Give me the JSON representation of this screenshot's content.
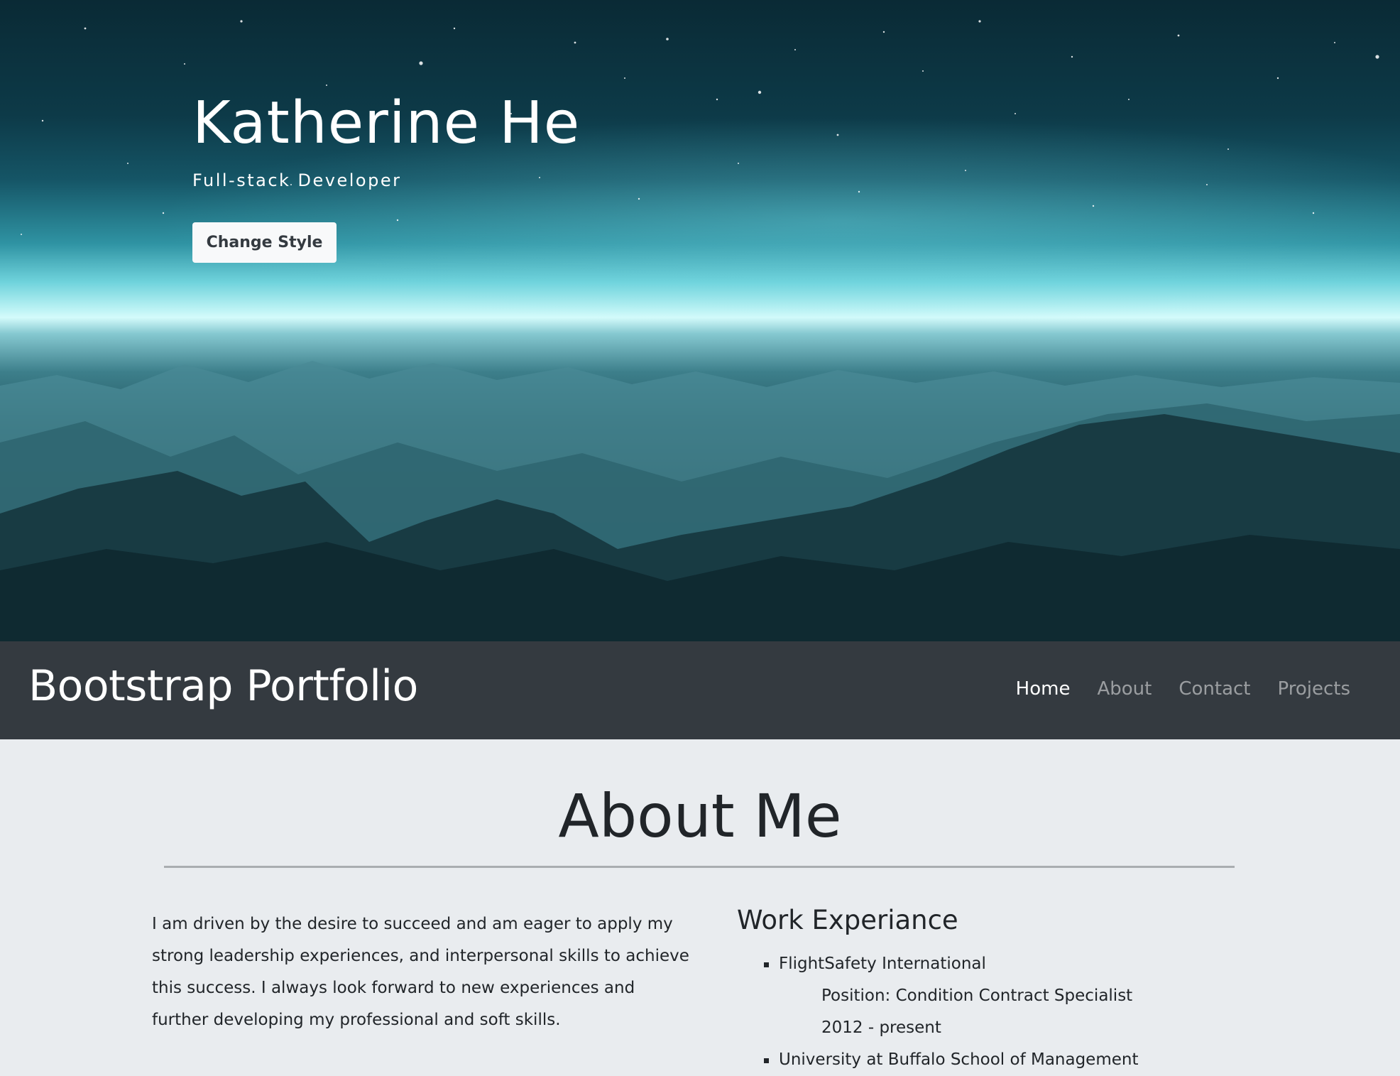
{
  "hero": {
    "name": "Katherine He",
    "subtitle": "Full-stack Developer",
    "button_label": "Change Style"
  },
  "navbar": {
    "brand": "Bootstrap Portfolio",
    "links": [
      {
        "label": "Home",
        "active": true
      },
      {
        "label": "About",
        "active": false
      },
      {
        "label": "Contact",
        "active": false
      },
      {
        "label": "Projects",
        "active": false
      }
    ],
    "background_color": "#343a40"
  },
  "about": {
    "title": "About Me",
    "paragraph": "I am driven by the desire to succeed and am eager to apply my strong leadership experiences, and interpersonal skills to achieve this success. I always look forward to new experiences and further developing my professional and soft skills.",
    "work": {
      "title": "Work Experiance",
      "items": [
        {
          "organization": "FlightSafety International",
          "position": "Position: Condition Contract Specialist",
          "period": "2012 - present"
        },
        {
          "organization": "University at Buffalo School of Management"
        }
      ]
    }
  }
}
